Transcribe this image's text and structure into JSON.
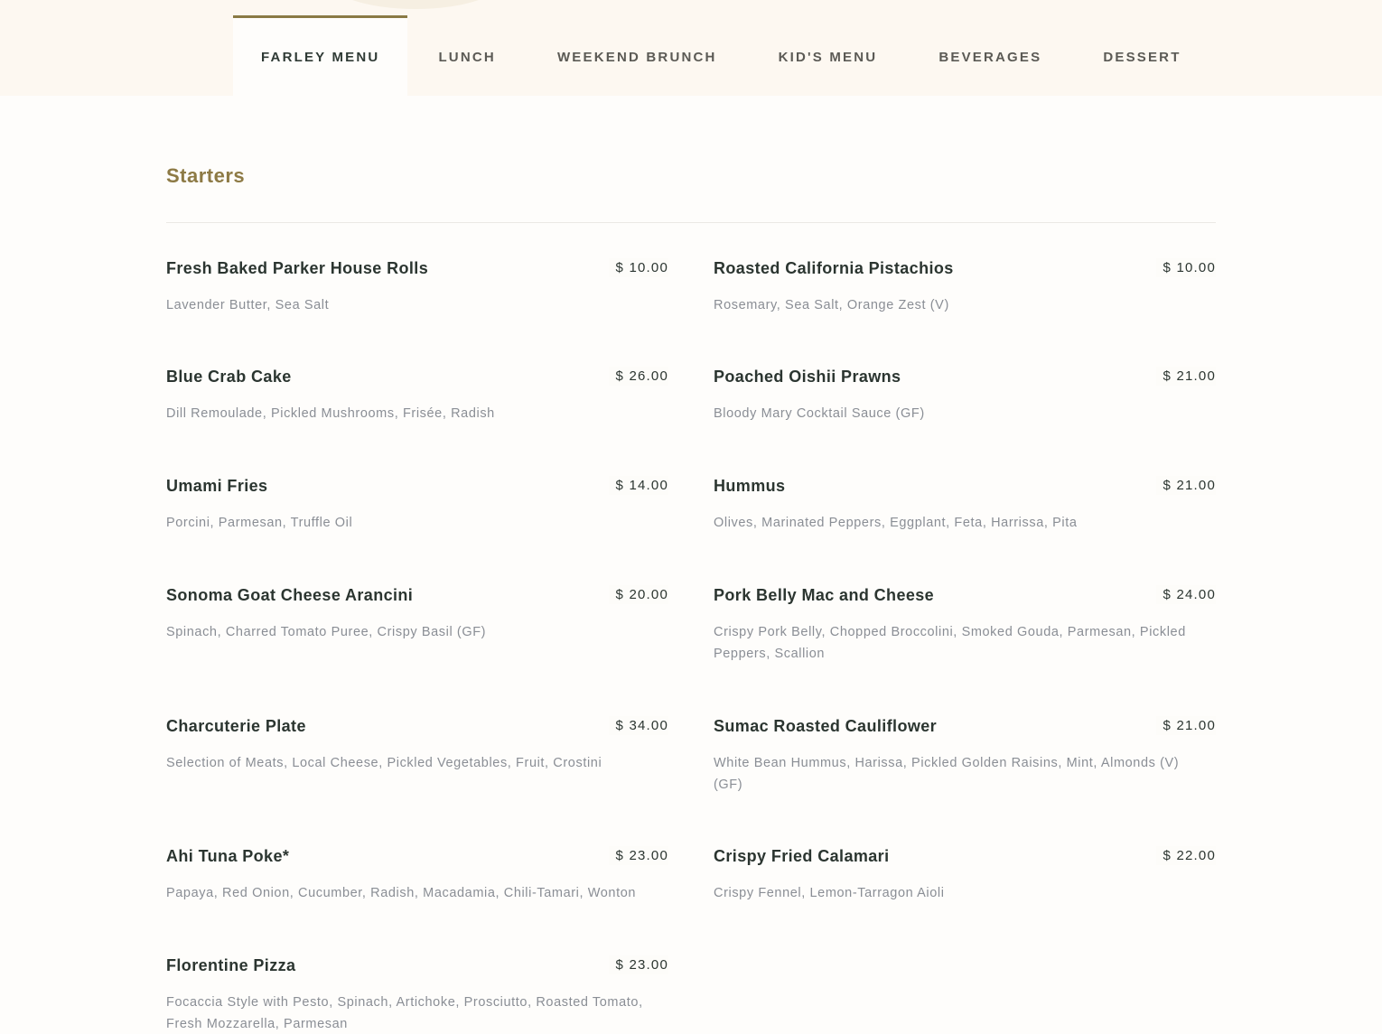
{
  "tabs": [
    {
      "label": "FARLEY MENU",
      "active": true
    },
    {
      "label": "LUNCH",
      "active": false
    },
    {
      "label": "WEEKEND BRUNCH",
      "active": false
    },
    {
      "label": "KID'S MENU",
      "active": false
    },
    {
      "label": "BEVERAGES",
      "active": false
    },
    {
      "label": "DESSERT",
      "active": false
    }
  ],
  "section": {
    "title": "Starters"
  },
  "left_items": [
    {
      "name": "Fresh Baked Parker House Rolls",
      "price": "$ 10.00",
      "desc": "Lavender Butter, Sea Salt"
    },
    {
      "name": "Blue Crab Cake",
      "price": "$ 26.00",
      "desc": "Dill Remoulade, Pickled Mushrooms, Frisée, Radish"
    },
    {
      "name": "Umami Fries",
      "price": "$ 14.00",
      "desc": "Porcini, Parmesan, Truffle Oil"
    },
    {
      "name": "Sonoma Goat Cheese Arancini",
      "price": "$ 20.00",
      "desc": "Spinach, Charred Tomato Puree, Crispy Basil (GF)"
    },
    {
      "name": "Charcuterie Plate",
      "price": "$ 34.00",
      "desc": "Selection of Meats, Local Cheese, Pickled Vegetables, Fruit, Crostini"
    },
    {
      "name": "Ahi Tuna Poke*",
      "price": "$ 23.00",
      "desc": "Papaya, Red Onion, Cucumber, Radish, Macadamia, Chili-Tamari, Wonton"
    },
    {
      "name": "Florentine Pizza",
      "price": "$ 23.00",
      "desc": "Focaccia Style with Pesto, Spinach, Artichoke, Prosciutto, Roasted Tomato, Fresh Mozzarella, Parmesan"
    }
  ],
  "right_items": [
    {
      "name": "Roasted California Pistachios",
      "price": "$ 10.00",
      "desc": "Rosemary, Sea Salt, Orange Zest (V)"
    },
    {
      "name": "Poached Oishii Prawns",
      "price": "$ 21.00",
      "desc": "Bloody Mary Cocktail Sauce (GF)"
    },
    {
      "name": "Hummus",
      "price": "$ 21.00",
      "desc": "Olives, Marinated Peppers, Eggplant, Feta, Harrissa, Pita"
    },
    {
      "name": "Pork Belly Mac and Cheese",
      "price": "$ 24.00",
      "desc": "Crispy Pork Belly, Chopped Broccolini, Smoked Gouda, Parmesan, Pickled Peppers, Scallion"
    },
    {
      "name": "Sumac Roasted Cauliflower",
      "price": "$ 21.00",
      "desc": "White Bean Hummus, Harissa, Pickled Golden Raisins, Mint, Almonds (V) (GF)"
    },
    {
      "name": "Crispy Fried Calamari",
      "price": "$ 22.00",
      "desc": "Crispy Fennel, Lemon-Tarragon Aioli"
    }
  ],
  "colors": {
    "accent": "#8d7a45",
    "text": "#2b3530",
    "muted": "#8a8e95",
    "tabbar_bg": "#fdf8f1"
  }
}
